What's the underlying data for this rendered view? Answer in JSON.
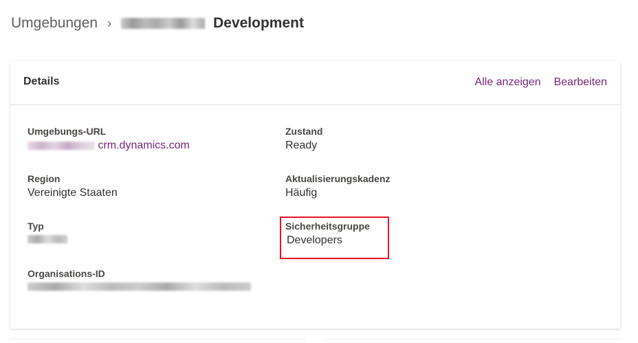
{
  "breadcrumb": {
    "root": "Umgebungen",
    "current": "Development"
  },
  "card": {
    "title": "Details",
    "show_all": "Alle anzeigen",
    "edit": "Bearbeiten",
    "fields": {
      "url": {
        "label": "Umgebungs-URL",
        "value_suffix": "crm.dynamics.com"
      },
      "state": {
        "label": "Zustand",
        "value": "Ready"
      },
      "region": {
        "label": "Region",
        "value": "Vereinigte Staaten"
      },
      "cadence": {
        "label": "Aktualisierungskadenz",
        "value": "Häufig"
      },
      "type": {
        "label": "Typ"
      },
      "security": {
        "label": "Sicherheitsgruppe",
        "value": "Developers"
      },
      "org": {
        "label": "Organisations-ID"
      }
    }
  },
  "colors": {
    "link": "#742774",
    "highlight": "#e81123"
  }
}
